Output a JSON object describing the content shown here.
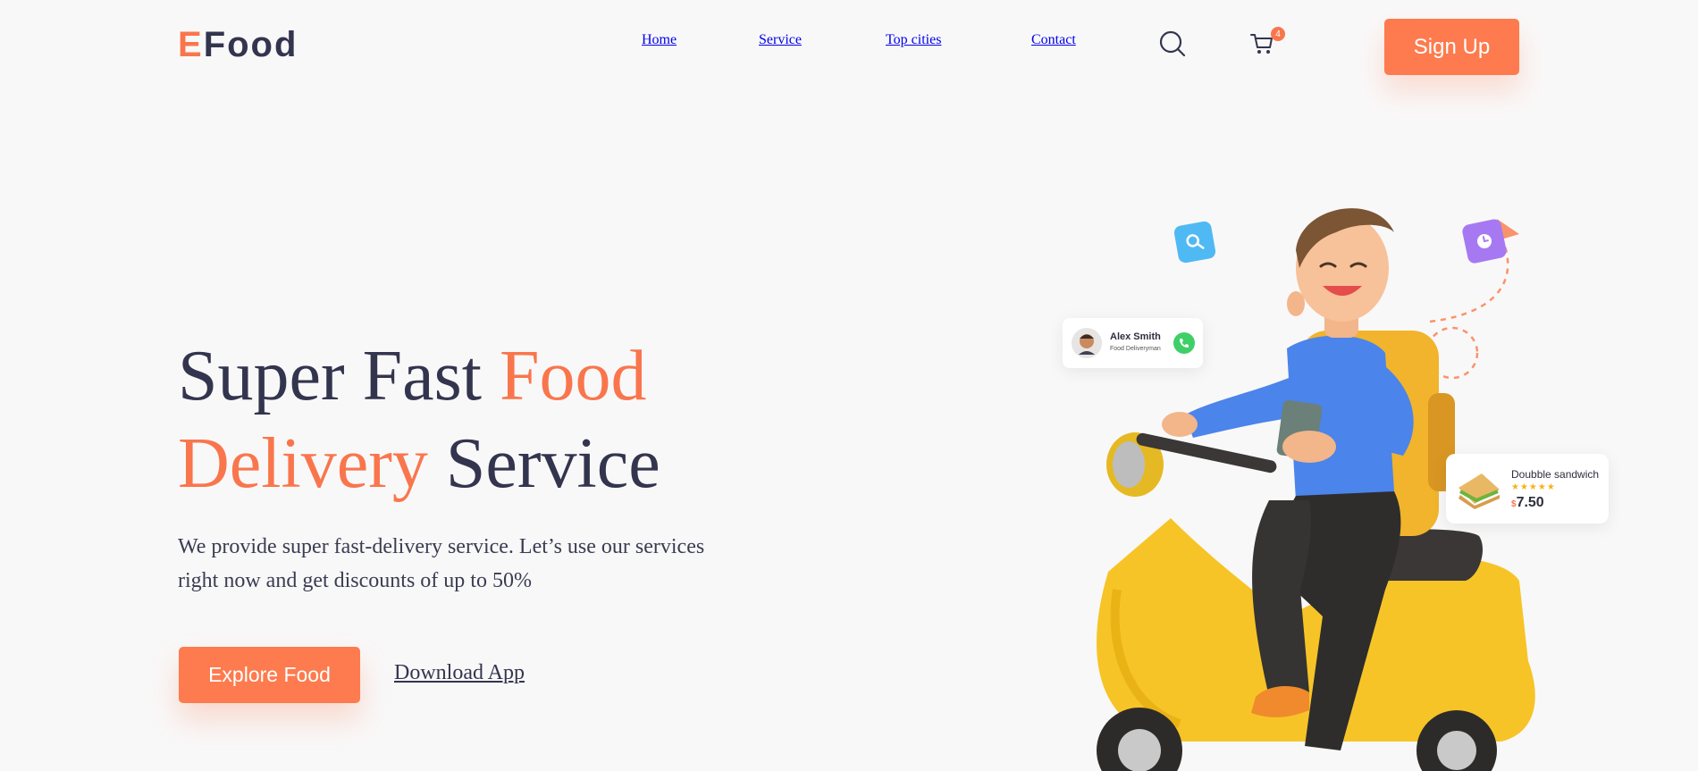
{
  "brand": {
    "first_letter": "E",
    "rest": "Food"
  },
  "nav": {
    "items": [
      {
        "label": "Home"
      },
      {
        "label": "Service"
      },
      {
        "label": "Top cities"
      },
      {
        "label": "Contact"
      }
    ],
    "search_icon": "search-icon",
    "cart_icon": "cart-icon",
    "cart_count": "4",
    "signup_label": "Sign Up"
  },
  "hero": {
    "title_part1": "Super Fast ",
    "title_part2": "Food",
    "title_part3": "Delivery",
    "title_part4": " Service",
    "description_line1": "We provide super fast-delivery service. Let’s use our services",
    "description_line2": "right now and get discounts of up to 50%",
    "primary_button": "Explore Food",
    "secondary_link": "Download App"
  },
  "illustration": {
    "delivery_card": {
      "name": "Alex Smith",
      "role": "Food Deliveryman"
    },
    "food_card": {
      "name": "Doubble sandwich",
      "rating": 4.5,
      "currency": "$",
      "price": "7.50"
    }
  },
  "colors": {
    "accent": "#f9764d",
    "text": "#33354f",
    "background": "#f9f8f8"
  }
}
